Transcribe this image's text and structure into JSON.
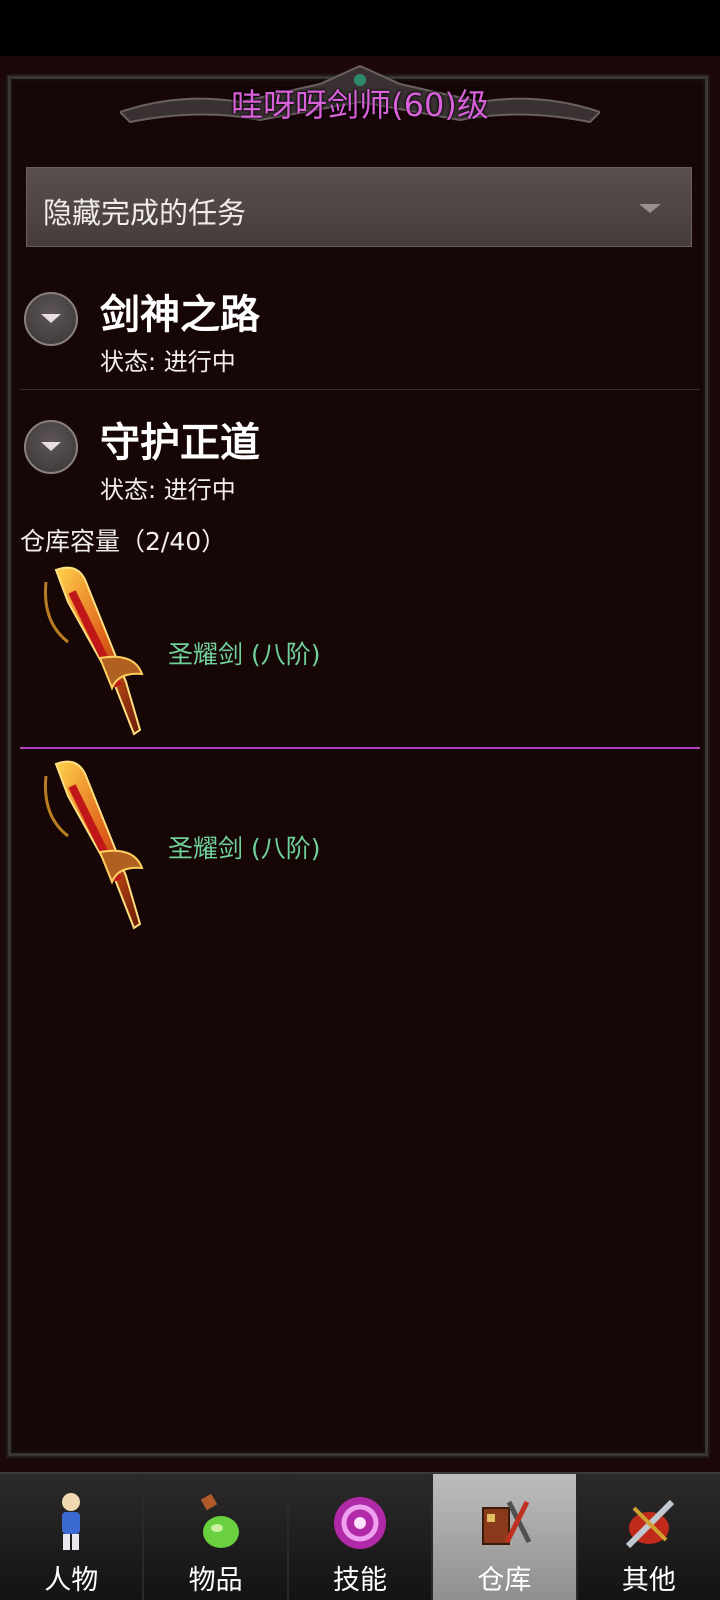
{
  "header": {
    "title": "哇呀呀剑师(60)级"
  },
  "filter": {
    "label": "隐藏完成的任务"
  },
  "quests": [
    {
      "name": "剑神之路",
      "status": "状态: 进行中"
    },
    {
      "name": "守护正道",
      "status": "状态: 进行中"
    }
  ],
  "warehouse": {
    "capacity_label": "仓库容量（2/40）",
    "items": [
      {
        "name": "圣耀剑 (八阶)",
        "icon": "flaming-sword-icon"
      },
      {
        "name": "圣耀剑 (八阶)",
        "icon": "flaming-sword-icon"
      }
    ]
  },
  "tabs": [
    {
      "label": "人物",
      "icon": "character-icon"
    },
    {
      "label": "物品",
      "icon": "potion-icon"
    },
    {
      "label": "技能",
      "icon": "skill-orb-icon"
    },
    {
      "label": "仓库",
      "icon": "warehouse-icon",
      "active": true
    },
    {
      "label": "其他",
      "icon": "other-icon"
    }
  ],
  "colors": {
    "title": "#d860d8",
    "item_name": "#70d09a",
    "divider": "#b040c0",
    "background": "#170606"
  }
}
